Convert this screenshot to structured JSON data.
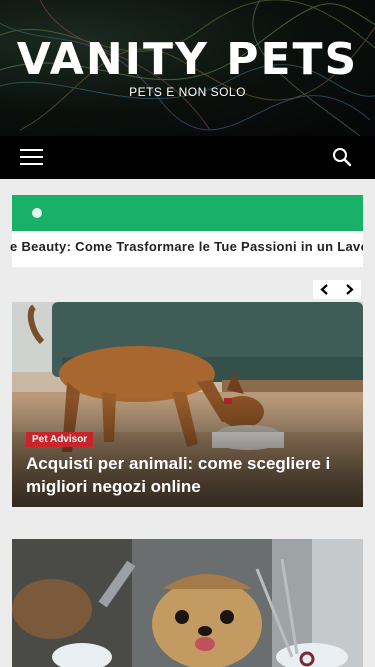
{
  "site": {
    "title": "VANITY PETS",
    "tagline": "PETS E NON SOLO"
  },
  "nav": {
    "menu_icon": "hamburger-menu-icon",
    "search_icon": "search-icon"
  },
  "ticker": {
    "headline": "e Beauty: Come Trasformare le Tue Passioni in un Lavoro"
  },
  "slider": {
    "prev_icon": "chevron-left-icon",
    "next_icon": "chevron-right-icon"
  },
  "posts": [
    {
      "category": "Pet Advisor",
      "title": "Acquisti per animali: come scegliere i migliori negozi online"
    }
  ],
  "colors": {
    "ticker_accent": "#19b06a",
    "category_badge": "#c8242c",
    "navbar": "#000000"
  }
}
